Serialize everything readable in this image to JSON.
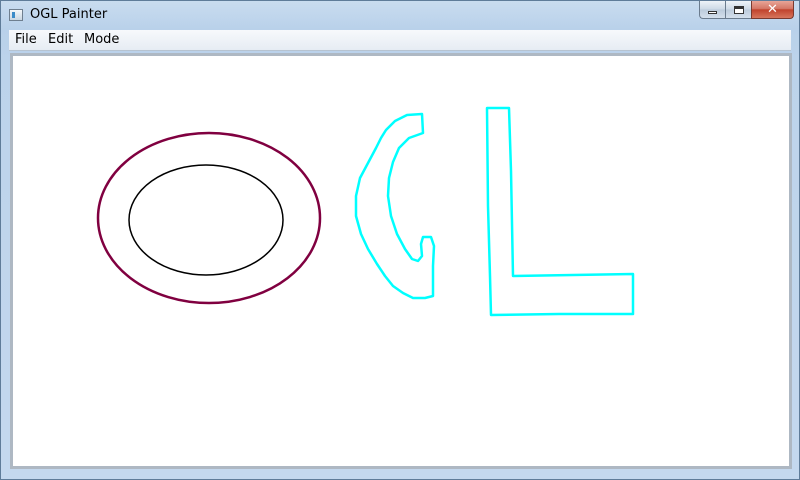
{
  "window": {
    "title": "OGL Painter",
    "icon": "app-window-icon"
  },
  "caption_buttons": {
    "minimize_icon": "minimize-icon",
    "maximize_icon": "maximize-icon",
    "close_glyph": "✕"
  },
  "menubar": {
    "items": [
      {
        "label": "File"
      },
      {
        "label": "Edit"
      },
      {
        "label": "Mode"
      }
    ]
  },
  "canvas": {
    "background": "#ffffff",
    "strokes": [
      {
        "name": "outer-ellipse",
        "shape": "ellipse",
        "color": "#800040"
      },
      {
        "name": "inner-ellipse",
        "shape": "ellipse",
        "color": "#000000"
      },
      {
        "name": "letter-g-stroke",
        "shape": "freehand",
        "color": "#00ffff"
      },
      {
        "name": "letter-l-stroke",
        "shape": "freehand",
        "color": "#00ffff"
      }
    ]
  }
}
